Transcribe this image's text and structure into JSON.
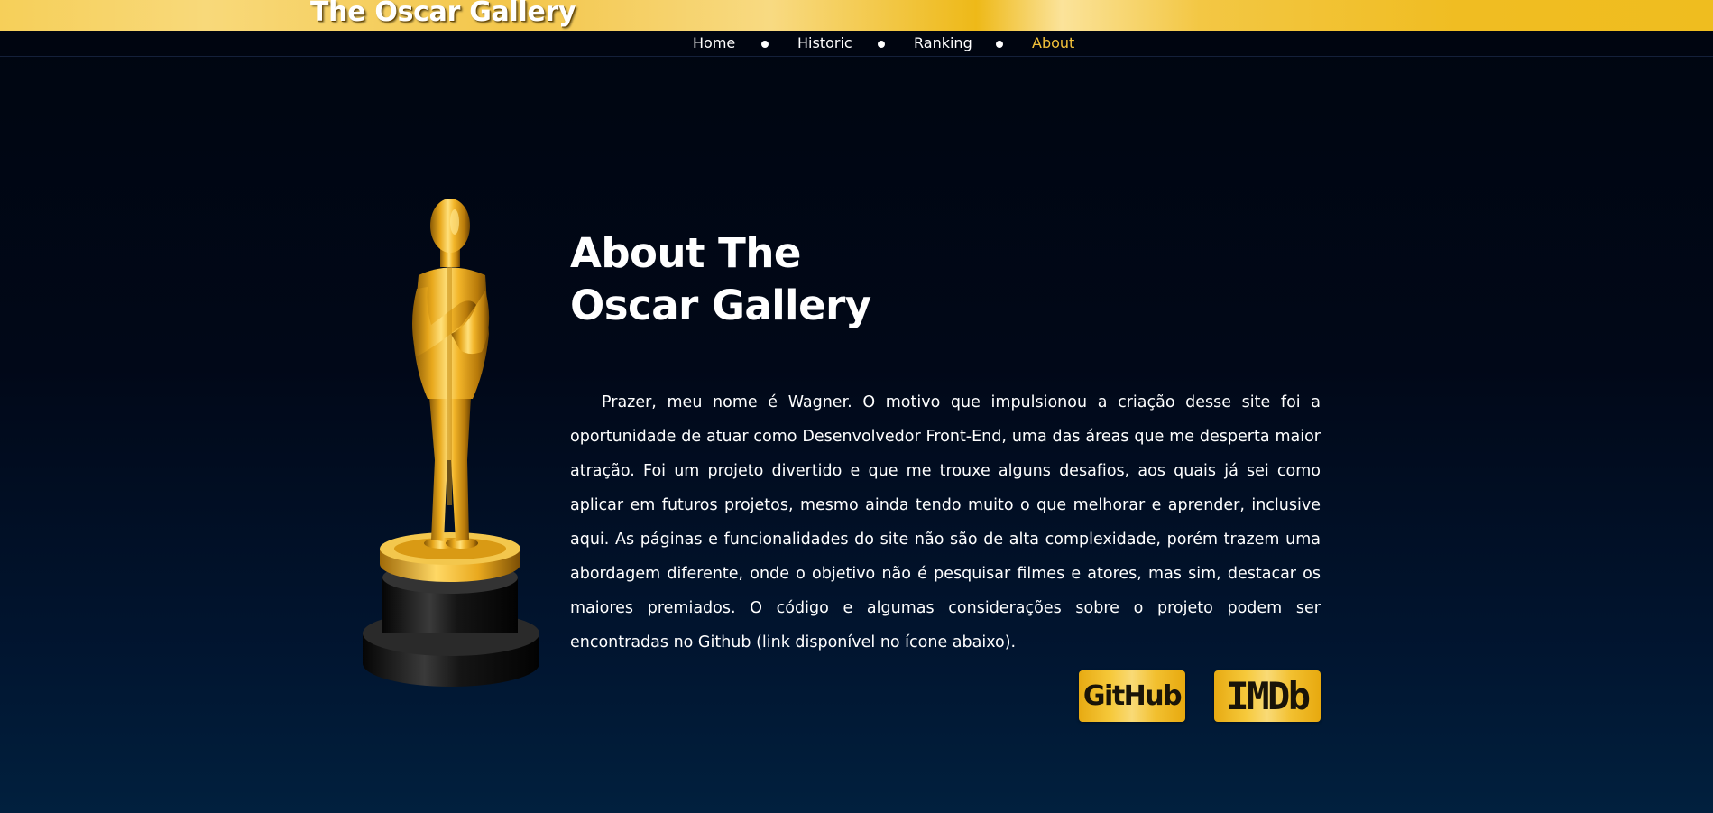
{
  "header": {
    "site_title": "The Oscar Gallery"
  },
  "nav": {
    "items": [
      {
        "label": "Home",
        "active": false
      },
      {
        "label": "Historic",
        "active": false
      },
      {
        "label": "Ranking",
        "active": false
      },
      {
        "label": "About",
        "active": true
      }
    ],
    "separator_icon": "dot-icon"
  },
  "about": {
    "title_line1": "About The",
    "title_line2": "Oscar Gallery",
    "paragraph": "Prazer, meu nome é Wagner. O motivo que impulsionou a criação desse site foi a oportunidade de atuar como Desenvolvedor Front-End, uma das áreas que me desperta maior atração. Foi um projeto divertido e que me trouxe alguns desafios, aos quais já sei como aplicar em futuros projetos, mesmo ainda tendo muito o que melhorar e aprender, inclusive aqui. As páginas e funcionalidades do site não são de alta complexidade, porém trazem uma abordagem diferente, onde o objetivo não é pesquisar filmes e atores, mas sim, destacar os maiores premiados. O código e algumas considerações sobre o projeto podem ser encontradas no Github (link disponível no ícone abaixo).",
    "image": "oscar-statue-image"
  },
  "links": {
    "github_label": "GitHub",
    "imdb_label": "IMDb"
  },
  "colors": {
    "accent_gold": "#f3c23a",
    "background_dark": "#000510",
    "background_bottom": "#01203e"
  }
}
